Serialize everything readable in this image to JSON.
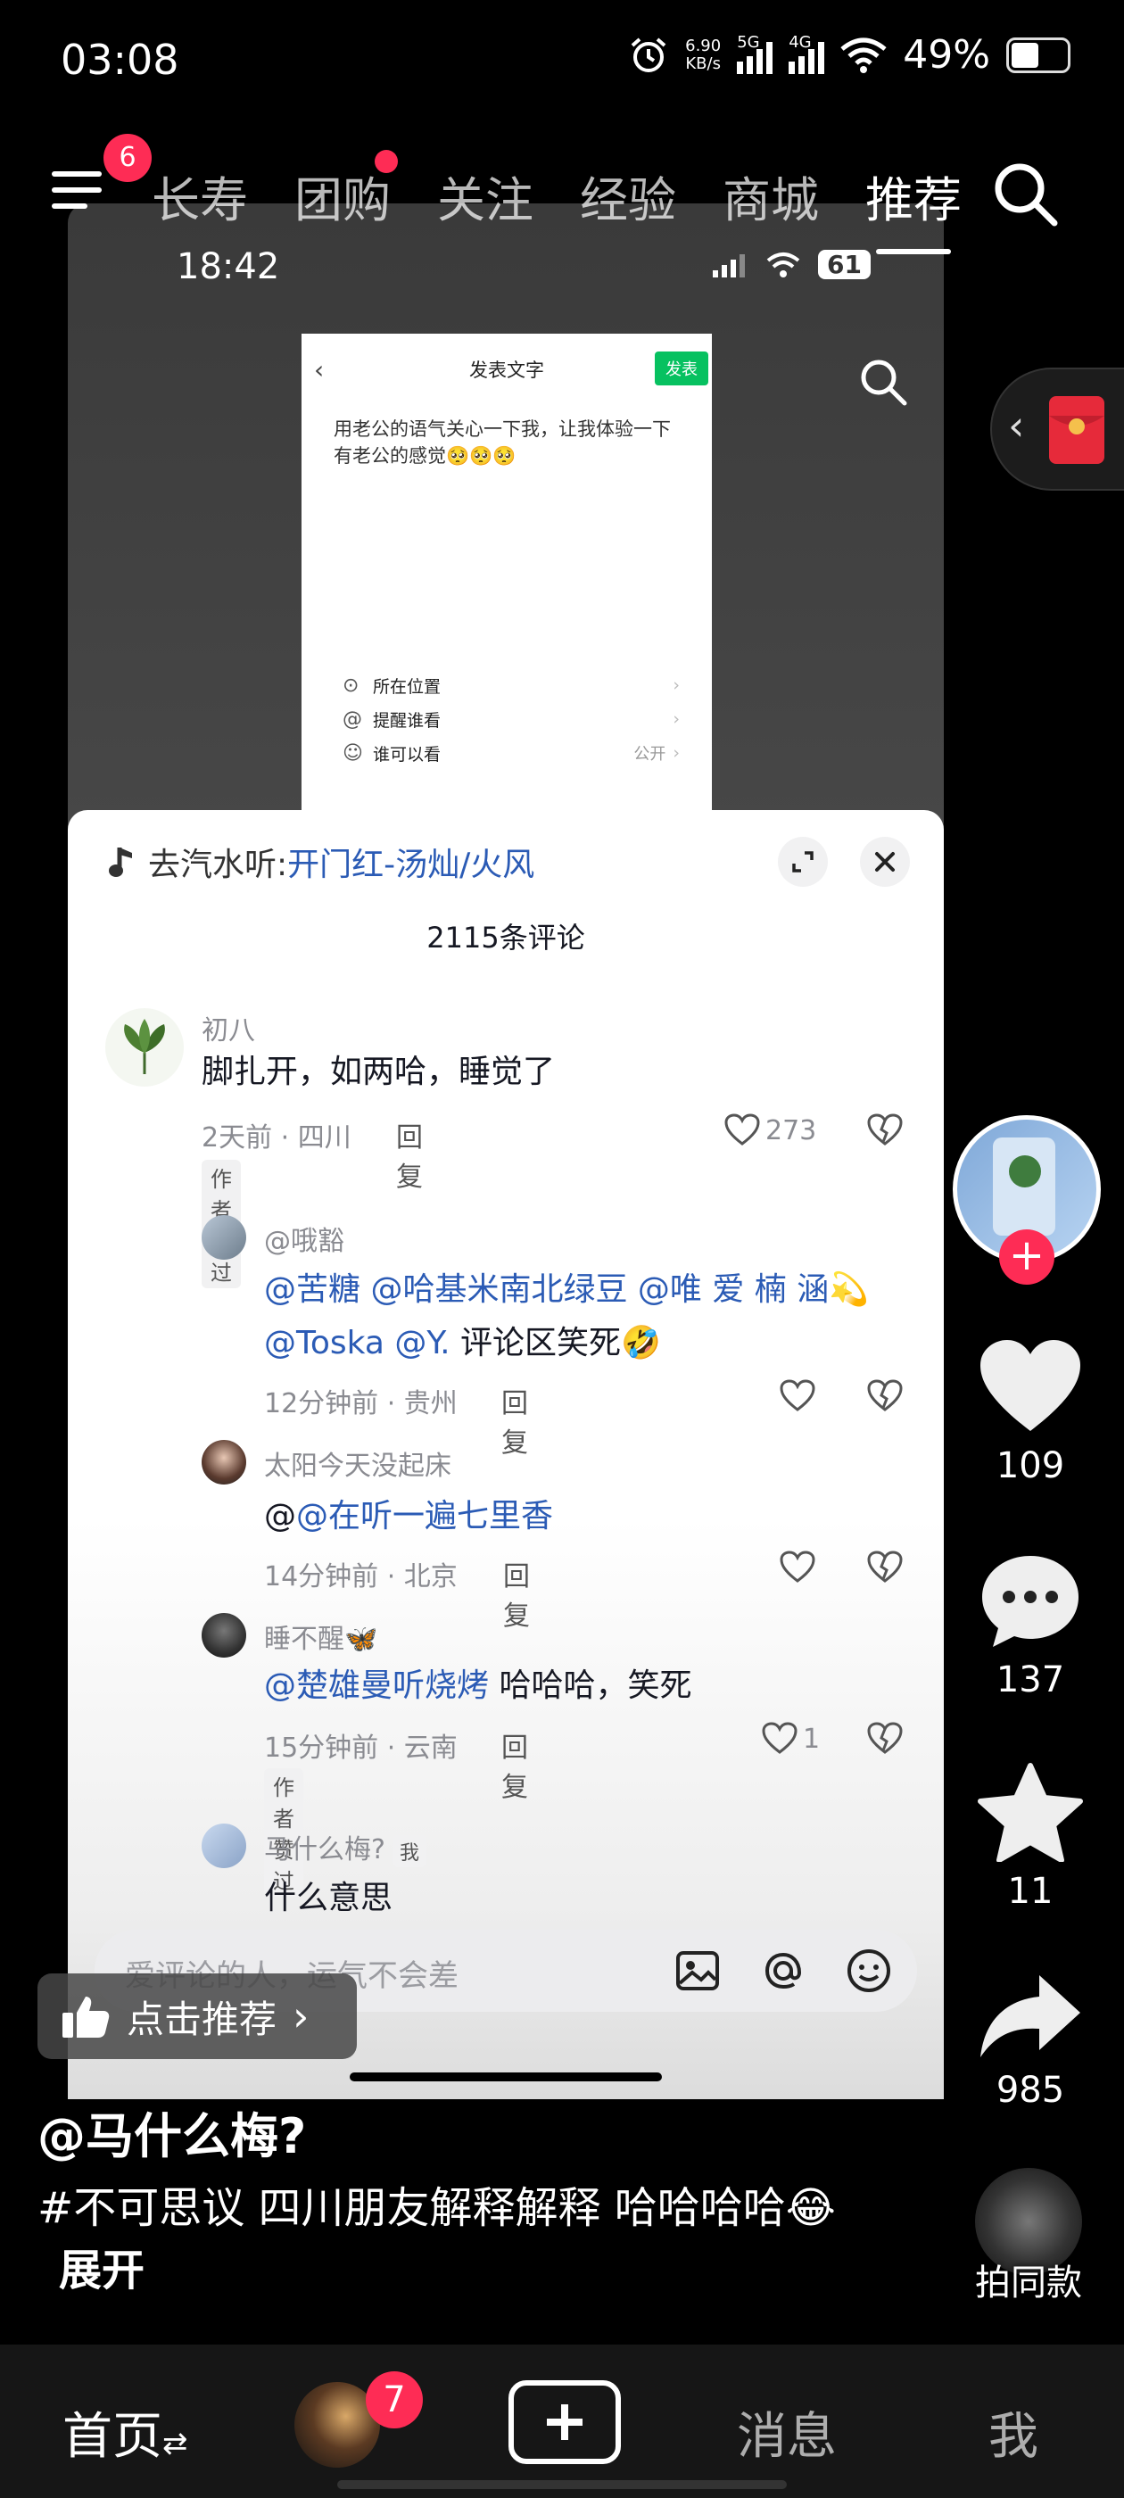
{
  "status_bar": {
    "time": "03:08",
    "net_speed": "6.90",
    "net_unit": "KB/s",
    "sig1": "5G",
    "sig2": "4G",
    "battery": "49%"
  },
  "top_nav": {
    "menu_badge": "6",
    "tabs": [
      "长寿",
      "团购",
      "关注",
      "经验",
      "商城",
      "推荐"
    ],
    "active_tab": "推荐"
  },
  "video": {
    "inner_time": "18:42",
    "inner_battery": "61",
    "screenshot": {
      "title": "发表文字",
      "send": "发表",
      "text": "用老公的语气关心一下我，让我体验一下有老公的感觉🥺🥺🥺",
      "rows": [
        {
          "icon": "⊙",
          "label": "所在位置",
          "value": ""
        },
        {
          "icon": "@",
          "label": "提醒谁看",
          "value": ""
        },
        {
          "icon": "☺",
          "label": "谁可以看",
          "value": "公开"
        }
      ]
    }
  },
  "sheet": {
    "music_prefix": "去汽水听:",
    "music_song": "开门红-汤灿/火风",
    "count": "2115条评论",
    "comments": [
      {
        "user": "初八",
        "text": "脚扎开，如两哈，睡觉了",
        "meta": "2天前 · 四川",
        "reply": "回复",
        "likes": "273",
        "tag": "作者赞过"
      },
      {
        "user": "@哦豁",
        "line1_mentions": "@苦糖 @哈基米南北绿豆 @唯 爱 楠  涵",
        "line1_emoji": "💫",
        "line2_mentions": "@Toska @Y.",
        "line2_text": " 评论区笑死",
        "line2_emoji": "🤣",
        "meta": "12分钟前 · 贵州",
        "reply": "回复"
      },
      {
        "user": "太阳今天没起床",
        "text_prefix": "@",
        "mention": "@在听一遍七里香",
        "meta": "14分钟前 · 北京",
        "reply": "回复"
      },
      {
        "user": "睡不醒",
        "user_emoji": "🦋",
        "mention": "@楚雄曼听烧烤",
        "text": " 哈哈哈，笑死",
        "meta": "15分钟前 · 云南",
        "reply": "回复",
        "likes": "1",
        "tag": "作者赞过"
      },
      {
        "user": "马什么梅?",
        "me": "我",
        "text": "什么意思"
      }
    ],
    "input_placeholder": "爱评论的人，运气不会差"
  },
  "recommend_chip": "点击推荐",
  "rail": {
    "likes": "109",
    "comments": "137",
    "favorites": "11",
    "shares": "985",
    "same_style": "拍同款"
  },
  "caption": {
    "author": "@马什么梅?",
    "text": "#不可思议 四川朋友解释解释 哈哈哈哈😂",
    "expand": "展开"
  },
  "bottom_nav": {
    "home": "首页",
    "home_switch": "⇄",
    "friend_badge": "7",
    "messages": "消息",
    "me": "我"
  },
  "colors": {
    "accent": "#fe2c55",
    "mention": "#2b5bb5",
    "send": "#07c160"
  }
}
